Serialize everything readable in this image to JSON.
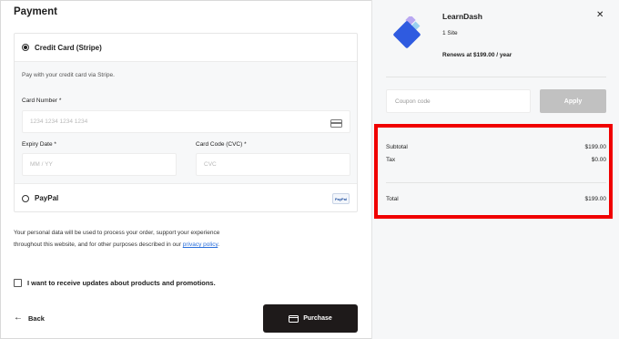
{
  "payment": {
    "title": "Payment",
    "credit_card": {
      "label": "Credit Card (Stripe)",
      "description": "Pay with your credit card via Stripe.",
      "card_number_label": "Card Number *",
      "card_number_placeholder": "1234 1234 1234 1234",
      "expiry_label": "Expiry Date *",
      "expiry_placeholder": "MM / YY",
      "cvc_label": "Card Code (CVC) *",
      "cvc_placeholder": "CVC"
    },
    "paypal": {
      "label": "PayPal",
      "badge": "PayPal"
    },
    "privacy": {
      "text": "Your personal data will be used to process your order, support your experience throughout this website, and for other purposes described in our ",
      "link": "privacy policy",
      "end": "."
    },
    "opt_in_label": "I want to receive updates about products and promotions.",
    "back_label": "Back",
    "purchase_label": "Purchase"
  },
  "summary": {
    "product_name": "LearnDash",
    "sites": "1 Site",
    "renews": "Renews at $199.00 / year",
    "coupon_placeholder": "Coupon code",
    "apply_label": "Apply",
    "subtotal_label": "Subtotal",
    "subtotal_value": "$199.00",
    "tax_label": "Tax",
    "tax_value": "$0.00",
    "total_label": "Total",
    "total_value": "$199.00"
  },
  "colors": {
    "accent_button": "#1e1a1a",
    "apply_disabled": "#c1c1c1",
    "highlight": "#f00000",
    "logo_blue": "#2f5be0",
    "logo_lavender": "#b9a8f2"
  },
  "icons": {
    "close": "close-icon",
    "card": "credit-card-icon",
    "back": "arrow-left-icon"
  }
}
